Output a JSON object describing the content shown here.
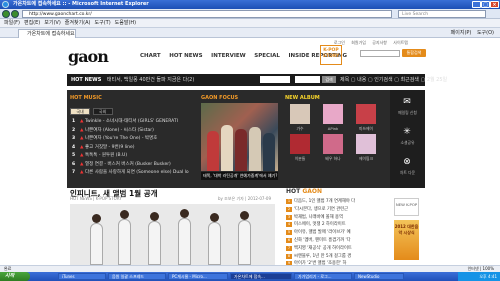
{
  "window": {
    "title": "가온차트에 접속하세요 :: - Microsoft Internet Explorer"
  },
  "address": {
    "url": "http://www.gaonchart.co.kr/",
    "search_placeholder": "Live Search"
  },
  "menubar": {
    "items": [
      "파일(F)",
      "편집(E)",
      "보기(V)",
      "즐겨찾기(A)",
      "도구(T)",
      "도움말(H)"
    ]
  },
  "tabbar": {
    "tab_title": "가온차트에 접속하세요",
    "tools": [
      "페이지(P)",
      "도구(O)"
    ]
  },
  "site": {
    "logo": "gaon",
    "top_links": [
      "로그인",
      "회원가입",
      "공지사항",
      "사이트맵"
    ],
    "top_search_button": "통합검색",
    "nav": [
      "CHART",
      "HOT NEWS",
      "INTERVIEW",
      "SPECIAL",
      "INSIDE REPORTING"
    ],
    "kpop": "K-POP STORY",
    "newsbar": {
      "label": "HOT NEWS",
      "headline": "태티서, 백일몽 40만건 돌파 지금은 다(2)",
      "links": "제목 ▢ 내용 ▢ 인기검색 ▢ 최근검색 ▢ 2월 25일"
    },
    "search_go": "검색"
  },
  "hot_music": {
    "title": "HOT MUSIC",
    "tabs": [
      "국내",
      "국외"
    ],
    "chart": [
      {
        "rank": "1",
        "title": "Twinkle - 소녀시대-태티서 (GIRLS' GENERATI"
      },
      {
        "rank": "2",
        "title": "나쁜여자 (Alone) - 씨스타 (Sistar)"
      },
      {
        "rank": "3",
        "title": "나쁜여자 (You're The One) - 박명호"
      },
      {
        "rank": "4",
        "title": "좋고 거짓말 - 9번(9 line)"
      },
      {
        "rank": "5",
        "title": "톡톡톡 - 원투원 (B.U)"
      },
      {
        "rank": "6",
        "title": "열정 연결 - 버스커 버스커 (Busker Busker)"
      },
      {
        "rank": "7",
        "title": "다른 사람을 사랑하게 되면 (Someone else) Dual lo"
      }
    ]
  },
  "gaon_focus": {
    "title": "GAON FOCUS",
    "caption": "태쪽, '대박 라틴공개' 연예가중계'에서 얘기?"
  },
  "new_album": {
    "title": "NEW ALBUM",
    "albums": [
      "가수",
      "APink",
      "미쓰에이",
      "이분들",
      "배우 하나",
      "에이핑크"
    ]
  },
  "utilities": [
    {
      "icon": "✉",
      "label": "메일링 신청"
    },
    {
      "icon": "✳",
      "label": "소셜공유"
    },
    {
      "icon": "⊗",
      "label": "차트 다운"
    }
  ],
  "article": {
    "title": "인피니트, 새 앨범 1월 공개",
    "meta": "HOT NEWS  |  K-POP STORY",
    "date": "by 조보은 기자  |  2012-07-09"
  },
  "hot_gaon": {
    "title_prefix": "HOT",
    "title_suffix": "GAON",
    "items": [
      "다음드, 1인 앨범 7개 연계해야 다",
      "'다시본다, 생으로 기연 관련근",
      "박재범, 나래바에 올해 용역 ",
      "미스에이, 멋쟁 2 하이라이트 ",
      "아이유, 앨범 발매 '라이브가' 예",
      "신화 '멤버, 팬미트 흥겹기까 '다",
      "백지영 '재공식' 공개 하이라이트",
      "씨엔블루, 1년 만 5개 걸그룹 경",
      "아이가 '2'번 앨범 '조용한' 하 "
    ]
  },
  "ads": {
    "side_top": "NEW K-POP",
    "side_box": "2012 대한음악 시상식"
  },
  "status": {
    "left": "완료",
    "right": "인터넷  |  100%"
  },
  "taskbar": {
    "start": "시작",
    "tasks": [
      "iTunes",
      "음원 일괄 스프레드",
      "PC게시물 - Micro...",
      "가온차트에 접속...",
      "가가업리기 - 로그...",
      "NewStudio"
    ],
    "active_index": 3,
    "tray": "오후 4:41"
  }
}
